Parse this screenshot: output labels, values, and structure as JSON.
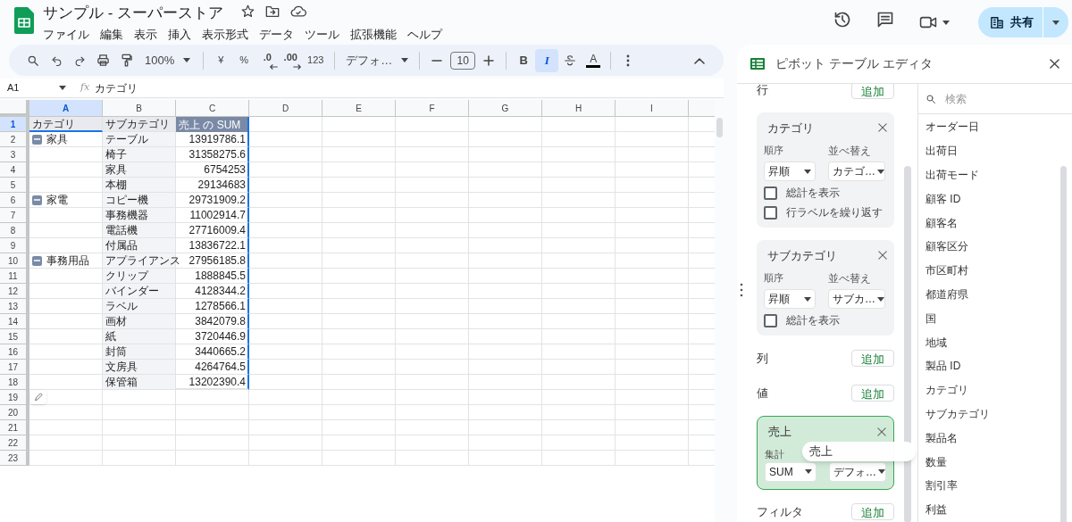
{
  "app": {
    "title": "サンプル - スーパーストア",
    "menu": [
      "ファイル",
      "編集",
      "表示",
      "挿入",
      "表示形式",
      "データ",
      "ツール",
      "拡張機能",
      "ヘルプ"
    ],
    "share": "共有"
  },
  "toolbar": {
    "zoom": "100%",
    "currency": "¥",
    "percent": "%",
    "decimal_decrease": ".0",
    "decimal_increase": ".00",
    "number_format": "123",
    "font": "デフォ…",
    "font_size": "10",
    "bold": {
      "label": "B",
      "selected": false
    },
    "italic": {
      "label": "I",
      "selected": true
    },
    "text_color": "A"
  },
  "formula_bar": {
    "cell_ref": "A1",
    "fx": "fx",
    "formula": "カテゴリ"
  },
  "sheet": {
    "columns": [
      {
        "label": "A",
        "selected": true
      },
      {
        "label": "B",
        "selected": false
      },
      {
        "label": "C",
        "selected": false
      },
      {
        "label": "D",
        "selected": false
      },
      {
        "label": "E",
        "selected": false
      },
      {
        "label": "F",
        "selected": false
      },
      {
        "label": "G",
        "selected": false
      },
      {
        "label": "H",
        "selected": false
      },
      {
        "label": "I",
        "selected": false
      }
    ],
    "rows": [
      {
        "number": "1",
        "selected": true,
        "kind": "header",
        "cells": [
          "カテゴリ",
          "サブカテゴリ",
          "売上 の SUM"
        ]
      },
      {
        "number": "2",
        "selected": false,
        "kind": "data",
        "group": "家具",
        "cells": [
          "テーブル",
          "13919786.1"
        ]
      },
      {
        "number": "3",
        "selected": false,
        "kind": "data",
        "cells": [
          "椅子",
          "31358275.6"
        ]
      },
      {
        "number": "4",
        "selected": false,
        "kind": "data",
        "cells": [
          "家具",
          "6754253"
        ]
      },
      {
        "number": "5",
        "selected": false,
        "kind": "data",
        "cells": [
          "本棚",
          "29134683"
        ]
      },
      {
        "number": "6",
        "selected": false,
        "kind": "data",
        "group": "家電",
        "cells": [
          "コピー機",
          "29731909.2"
        ]
      },
      {
        "number": "7",
        "selected": false,
        "kind": "data",
        "cells": [
          "事務機器",
          "11002914.7"
        ]
      },
      {
        "number": "8",
        "selected": false,
        "kind": "data",
        "cells": [
          "電話機",
          "27716009.4"
        ]
      },
      {
        "number": "9",
        "selected": false,
        "kind": "data",
        "cells": [
          "付属品",
          "13836722.1"
        ]
      },
      {
        "number": "10",
        "selected": false,
        "kind": "data",
        "group": "事務用品",
        "cells": [
          "アプライアンス",
          "27956185.8"
        ]
      },
      {
        "number": "11",
        "selected": false,
        "kind": "data",
        "cells": [
          "クリップ",
          "1888845.5"
        ]
      },
      {
        "number": "12",
        "selected": false,
        "kind": "data",
        "cells": [
          "バインダー",
          "4128344.2"
        ]
      },
      {
        "number": "13",
        "selected": false,
        "kind": "data",
        "cells": [
          "ラベル",
          "1278566.1"
        ]
      },
      {
        "number": "14",
        "selected": false,
        "kind": "data",
        "cells": [
          "画材",
          "3842079.8"
        ]
      },
      {
        "number": "15",
        "selected": false,
        "kind": "data",
        "cells": [
          "紙",
          "3720446.9"
        ]
      },
      {
        "number": "16",
        "selected": false,
        "kind": "data",
        "cells": [
          "封筒",
          "3440665.2"
        ]
      },
      {
        "number": "17",
        "selected": false,
        "kind": "data",
        "cells": [
          "文房具",
          "4264764.5"
        ]
      },
      {
        "number": "18",
        "selected": false,
        "kind": "data",
        "cells": [
          "保管箱",
          "13202390.4"
        ]
      },
      {
        "number": "19",
        "selected": false,
        "kind": "empty"
      },
      {
        "number": "20",
        "selected": false,
        "kind": "empty"
      },
      {
        "number": "21",
        "selected": false,
        "kind": "empty"
      },
      {
        "number": "22",
        "selected": false,
        "kind": "empty"
      },
      {
        "number": "23",
        "selected": false,
        "kind": "empty"
      }
    ]
  },
  "pivot_editor": {
    "title": "ピボット テーブル エディタ",
    "sections": [
      {
        "label": "行",
        "add": "追加",
        "cards": [
          {
            "kind": "row_field",
            "title": "カテゴリ",
            "order_label": "順序",
            "order": "昇順",
            "sort_label": "並べ替え",
            "sort": "カテゴ…",
            "checkboxes": [
              {
                "label": "総計を表示",
                "checked": false
              },
              {
                "label": "行ラベルを繰り返す",
                "checked": false
              }
            ]
          },
          {
            "kind": "row_field",
            "title": "サブカテゴリ",
            "order_label": "順序",
            "order": "昇順",
            "sort_label": "並べ替え",
            "sort": "サブカ…",
            "checkboxes": [
              {
                "label": "総計を表示",
                "checked": false
              }
            ]
          }
        ]
      },
      {
        "label": "列",
        "add": "追加"
      },
      {
        "label": "値",
        "add": "追加",
        "cards": [
          {
            "kind": "value_field",
            "title": "売上",
            "aggregate_label": "集計",
            "aggregate": "SUM",
            "display": "デフォ…",
            "drag_chip": "売上"
          }
        ]
      },
      {
        "label": "フィルタ",
        "add": "追加"
      }
    ],
    "search": {
      "placeholder": "検索"
    },
    "fields": [
      "オーダー日",
      "出荷日",
      "出荷モード",
      "顧客 ID",
      "顧客名",
      "顧客区分",
      "市区町村",
      "都道府県",
      "国",
      "地域",
      "製品 ID",
      "カテゴリ",
      "サブカテゴリ",
      "製品名",
      "数量",
      "割引率",
      "利益"
    ]
  }
}
